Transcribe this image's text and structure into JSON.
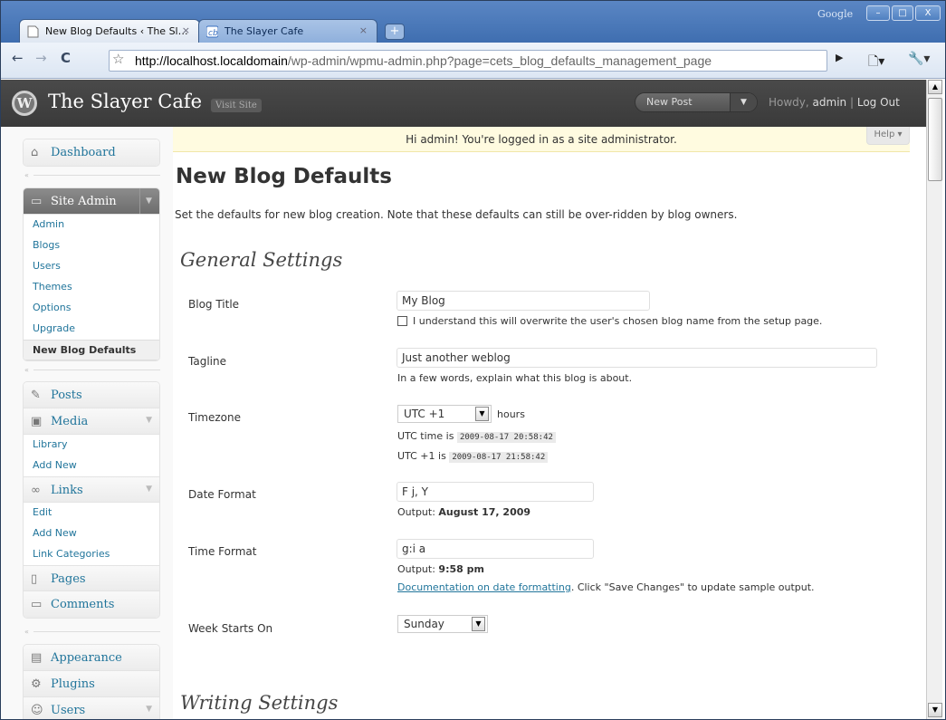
{
  "browser": {
    "tabs": [
      {
        "label": "New Blog Defaults ‹ The Sl…",
        "close": "×",
        "active": true
      },
      {
        "label": "The Slayer Cafe",
        "close": "×",
        "active": false
      }
    ],
    "new_tab": "+",
    "brand": "Google",
    "window_buttons": [
      "–",
      "□",
      "X"
    ],
    "url_host": "http://localhost.localdomain",
    "url_path": "/wp-admin/wpmu-admin.php?page=cets_blog_defaults_management_page"
  },
  "header": {
    "site_title": "The Slayer Cafe",
    "visit_site": "Visit Site",
    "new_post": "New Post",
    "howdy_prefix": "Howdy,",
    "user": "admin",
    "separator": "|",
    "logout": "Log Out"
  },
  "sidebar": {
    "dashboard": "Dashboard",
    "site_admin": {
      "label": "Site Admin",
      "items": [
        "Admin",
        "Blogs",
        "Users",
        "Themes",
        "Options",
        "Upgrade",
        "New Blog Defaults"
      ]
    },
    "posts": "Posts",
    "media": {
      "label": "Media",
      "items": [
        "Library",
        "Add New"
      ]
    },
    "links": {
      "label": "Links",
      "items": [
        "Edit",
        "Add New",
        "Link Categories"
      ]
    },
    "pages": "Pages",
    "comments": "Comments",
    "appearance": "Appearance",
    "plugins": "Plugins",
    "users": "Users"
  },
  "notice": "Hi admin! You're logged in as a site administrator.",
  "help": "Help ▾",
  "page": {
    "title": "New Blog Defaults",
    "description": "Set the defaults for new blog creation. Note that these defaults can still be over-ridden by blog owners."
  },
  "general": {
    "heading": "General Settings",
    "blog_title": {
      "label": "Blog Title",
      "value": "My Blog",
      "checkbox": "I understand this will overwrite the user's chosen blog name from the setup page."
    },
    "tagline": {
      "label": "Tagline",
      "value": "Just another  weblog",
      "hint": "In a few words, explain what this blog is about."
    },
    "timezone": {
      "label": "Timezone",
      "value": "UTC +1",
      "unit": "hours",
      "utc_label": "UTC time is",
      "utc_time": "2009-08-17 20:58:42",
      "local_label": "UTC +1 is",
      "local_time": "2009-08-17 21:58:42"
    },
    "date_format": {
      "label": "Date Format",
      "value": "F j, Y",
      "output_label": "Output:",
      "output": "August 17, 2009"
    },
    "time_format": {
      "label": "Time Format",
      "value": "g:i a",
      "output_label": "Output:",
      "output": "9:58 pm",
      "doc_link": "Documentation on date formatting",
      "doc_suffix": ". Click \"Save Changes\" to update sample output."
    },
    "week_starts": {
      "label": "Week Starts On",
      "value": "Sunday"
    }
  },
  "writing": {
    "heading": "Writing Settings"
  }
}
